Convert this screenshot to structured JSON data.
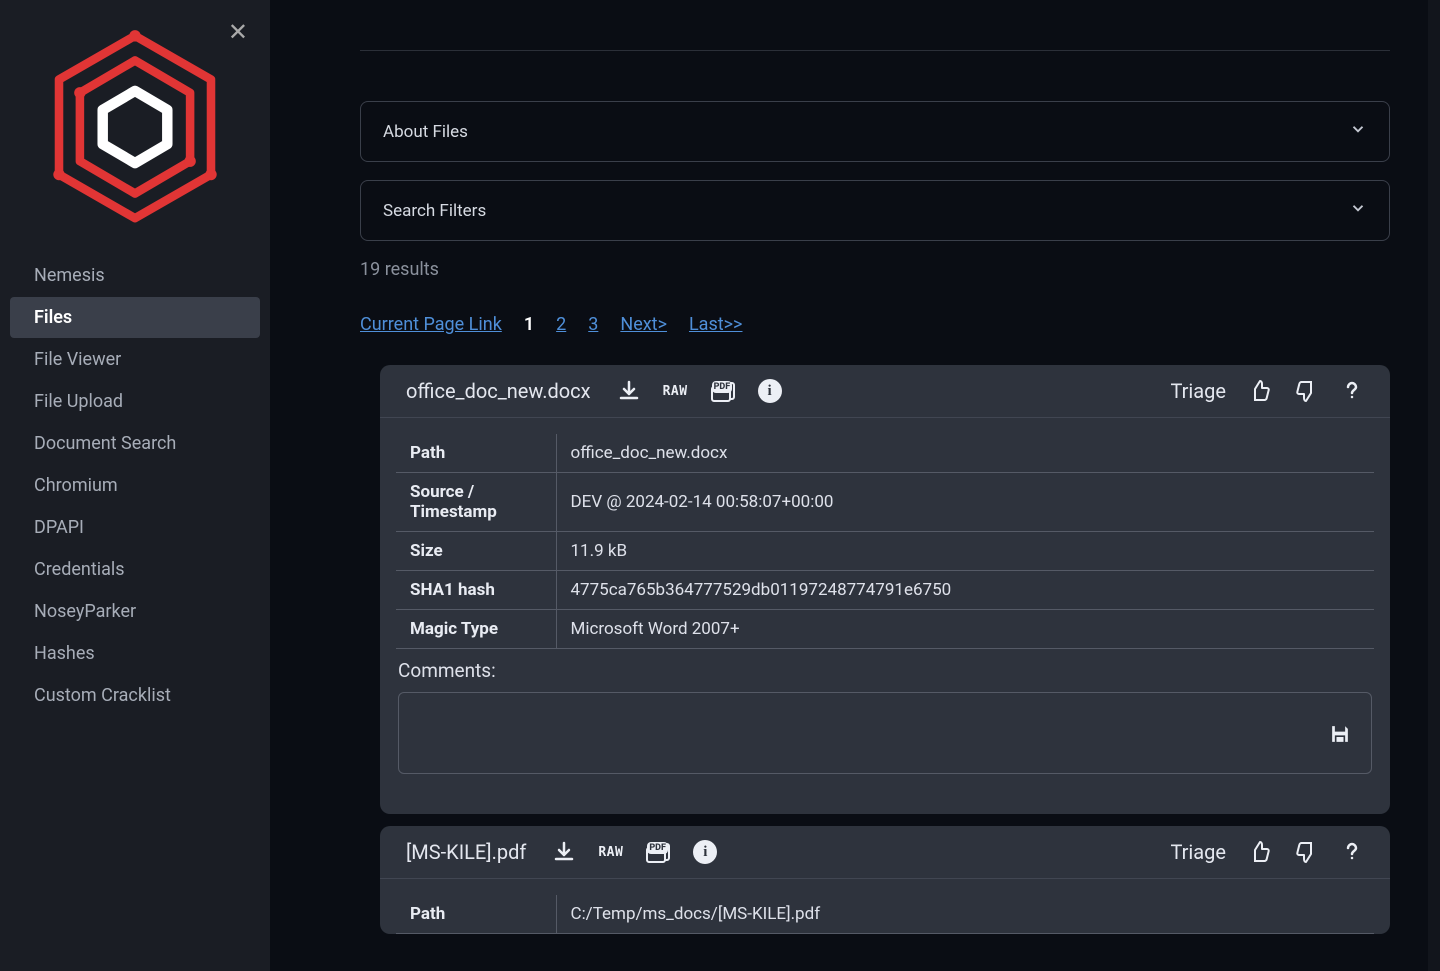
{
  "sidebar": {
    "items": [
      {
        "label": "Nemesis",
        "active": false
      },
      {
        "label": "Files",
        "active": true
      },
      {
        "label": "File Viewer",
        "active": false
      },
      {
        "label": "File Upload",
        "active": false
      },
      {
        "label": "Document Search",
        "active": false
      },
      {
        "label": "Chromium",
        "active": false
      },
      {
        "label": "DPAPI",
        "active": false
      },
      {
        "label": "Credentials",
        "active": false
      },
      {
        "label": "NoseyParker",
        "active": false
      },
      {
        "label": "Hashes",
        "active": false
      },
      {
        "label": "Custom Cracklist",
        "active": false
      }
    ]
  },
  "accordions": {
    "about": "About Files",
    "filters": "Search Filters"
  },
  "results_text": "19 results",
  "pagination": {
    "current_link_label": "Current Page Link",
    "pages": [
      "1",
      "2",
      "3"
    ],
    "next": "Next>",
    "last": "Last>>"
  },
  "triage_label": "Triage",
  "raw_label": "RAW",
  "pdf_label": "PDF",
  "comments_label": "Comments:",
  "row_labels": {
    "path": "Path",
    "source": "Source / Timestamp",
    "size": "Size",
    "sha1": "SHA1 hash",
    "magic": "Magic Type"
  },
  "files": [
    {
      "name": "office_doc_new.docx",
      "path": "office_doc_new.docx",
      "source": "DEV @ 2024-02-14 00:58:07+00:00",
      "size": "11.9 kB",
      "sha1": "4775ca765b364777529db01197248774791e6750",
      "magic": "Microsoft Word 2007+"
    },
    {
      "name": "[MS-KILE].pdf",
      "path": "C:/Temp/ms_docs/[MS-KILE].pdf"
    }
  ]
}
